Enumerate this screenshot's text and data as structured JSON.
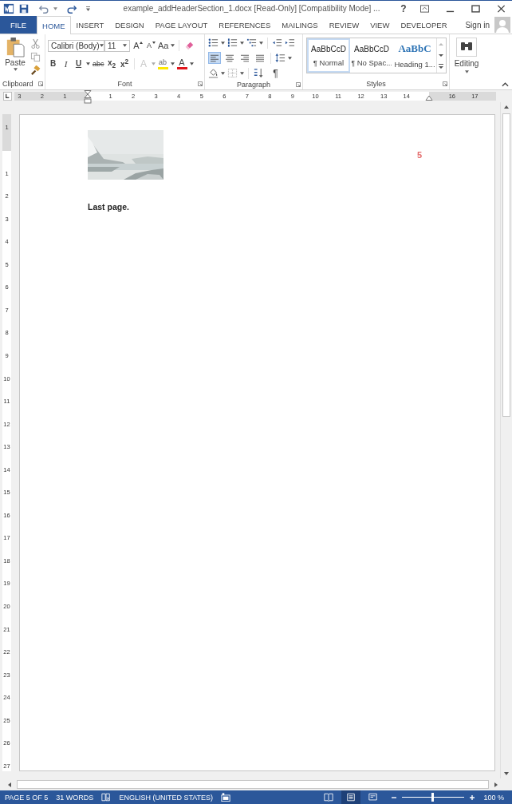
{
  "title_bar": {
    "title": "example_addHeaderSection_1.docx [Read-Only] [Compatibility Mode] ...",
    "help": "?"
  },
  "tabs": [
    {
      "label": "FILE",
      "kind": "file",
      "selected": false
    },
    {
      "label": "HOME",
      "kind": "tab",
      "selected": true
    },
    {
      "label": "INSERT",
      "kind": "tab",
      "selected": false
    },
    {
      "label": "DESIGN",
      "kind": "tab",
      "selected": false
    },
    {
      "label": "PAGE LAYOUT",
      "kind": "tab",
      "selected": false
    },
    {
      "label": "REFERENCES",
      "kind": "tab",
      "selected": false
    },
    {
      "label": "MAILINGS",
      "kind": "tab",
      "selected": false
    },
    {
      "label": "REVIEW",
      "kind": "tab",
      "selected": false
    },
    {
      "label": "VIEW",
      "kind": "tab",
      "selected": false
    },
    {
      "label": "DEVELOPER",
      "kind": "tab",
      "selected": false
    }
  ],
  "sign_in": "Sign in",
  "ribbon": {
    "clipboard": {
      "paste": "Paste",
      "label": "Clipboard"
    },
    "font": {
      "label": "Font",
      "name": "Calibri (Body)",
      "size": "11",
      "grow": "A",
      "shrink": "A",
      "case": "Aa",
      "bold": "B",
      "italic": "I",
      "underline": "U",
      "strikethrough": "abc",
      "subscript": "x$_{2}$",
      "superscript": "x$^{2}$",
      "effects": "A",
      "highlight": "ab",
      "font_color": "A"
    },
    "paragraph": {
      "label": "Paragraph",
      "marks": "¶",
      "alignments": [
        {
          "kind": "left",
          "selected": true
        },
        {
          "kind": "center",
          "selected": false
        },
        {
          "kind": "right",
          "selected": false
        },
        {
          "kind": "justify",
          "selected": false
        }
      ]
    },
    "styles": {
      "label": "Styles",
      "items": [
        {
          "preview": "AaBbCcD",
          "name": "¶ Normal",
          "kind": "normal",
          "selected": true
        },
        {
          "preview": "AaBbCcD",
          "name": "¶ No Spac...",
          "kind": "normal",
          "selected": false
        },
        {
          "preview": "AaBbC",
          "name": "Heading 1...",
          "kind": "heading",
          "selected": false
        }
      ]
    },
    "editing": {
      "label": "Editing"
    }
  },
  "ruler": {
    "left_labels": [
      "3",
      "2",
      "1"
    ],
    "right_labels": [
      "1",
      "2",
      "3",
      "4",
      "5",
      "6",
      "7",
      "8",
      "9",
      "10",
      "11",
      "12",
      "13",
      "14"
    ],
    "far_labels": [
      "16",
      "17"
    ]
  },
  "vertical_ruler": {
    "top_labels": [
      "1"
    ],
    "labels": [
      "1",
      "2",
      "3",
      "4",
      "5",
      "6",
      "7",
      "8",
      "9",
      "10",
      "11",
      "12",
      "13",
      "14",
      "15",
      "16",
      "17",
      "18",
      "19",
      "20",
      "21",
      "22",
      "23",
      "24",
      "25",
      "26",
      "27"
    ]
  },
  "document": {
    "page_number": "5",
    "text": "Last page."
  },
  "status_bar": {
    "page": "PAGE 5 OF 5",
    "words": "31 WORDS",
    "language": "ENGLISH (UNITED STATES)",
    "views": [
      {
        "kind": "read",
        "selected": false
      },
      {
        "kind": "print",
        "selected": true
      },
      {
        "kind": "web",
        "selected": false
      }
    ],
    "zoom": {
      "level": 0.5,
      "reading": "100 %"
    }
  }
}
